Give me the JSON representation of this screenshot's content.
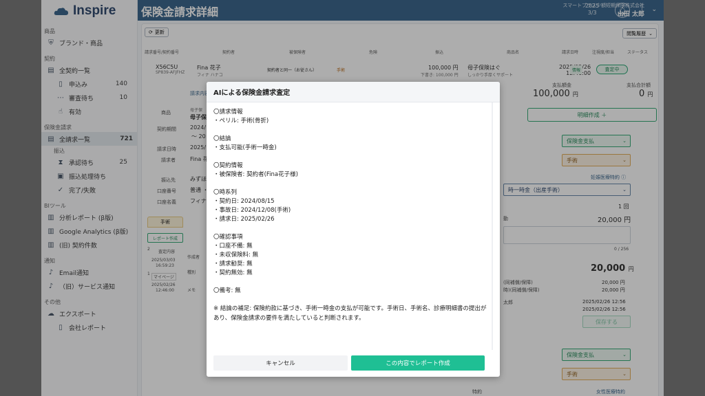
{
  "app": {
    "name": "Inspire"
  },
  "sidebar": {
    "groups": [
      {
        "label": "商品",
        "items": [
          {
            "label": "ブランド・商品",
            "icon": "shield-icon"
          }
        ]
      },
      {
        "label": "契約",
        "items": [
          {
            "label": "全契約一覧",
            "icon": "list-icon"
          },
          {
            "label": "申込み",
            "count": "140",
            "icon": "doc-icon"
          },
          {
            "label": "審査待ち",
            "count": "10",
            "icon": "dots-icon"
          },
          {
            "label": "有効",
            "icon": "hand-icon"
          }
        ]
      },
      {
        "label": "保険金請求",
        "items": [
          {
            "label": "全請求一覧",
            "count": "721",
            "icon": "list-icon"
          }
        ],
        "sublabel": "振込",
        "subitems": [
          {
            "label": "承認待ち",
            "count": "25",
            "icon": "hourglass-icon"
          },
          {
            "label": "振込処理待ち",
            "icon": "transfer-icon"
          },
          {
            "label": "完了/失敗",
            "icon": "done-icon"
          }
        ]
      },
      {
        "label": "BIツール",
        "items": [
          {
            "label": "分析レポート (β版)",
            "icon": "chart-icon"
          },
          {
            "label": "Google Analytics (β版)",
            "icon": "chart-icon"
          },
          {
            "label": "(旧) 契約件数",
            "icon": "chart-icon"
          }
        ]
      },
      {
        "label": "通知",
        "items": [
          {
            "label": "Email通知",
            "icon": "bell-icon"
          },
          {
            "label": "（旧）サービス通知",
            "icon": "bell-icon"
          }
        ]
      },
      {
        "label": "その他",
        "items": [
          {
            "label": "エクスポート",
            "icon": "cloud-icon"
          },
          {
            "label": "会社レポート",
            "icon": "doc-icon"
          }
        ]
      }
    ]
  },
  "header": {
    "title": "保険金請求詳細",
    "year": "2025",
    "date": "3/3",
    "company": "スマートプラス少額短期保険株式会社",
    "user": "山田 太郎"
  },
  "toolbar": {
    "refresh": "更新",
    "history": "閲覧履歴"
  },
  "table": {
    "headers": [
      "請求番号/契約番号",
      "契約者",
      "被保険者",
      "危険",
      "振込",
      "商品名",
      "請求日時",
      "注視度/担当",
      "ステータス"
    ],
    "row": {
      "claim_no": "X56C5U",
      "contract_no": "SP839-AFJFHZ",
      "holder": "Fina 花子",
      "holder_kana": "フィナ ハナコ",
      "insured": "契約者と同一（お従さん）",
      "peril": "手術",
      "amount": "100,000 円",
      "amount_sub": "下書き: 100,000 円",
      "product": "母子保険はぐ",
      "product_sub": "しっかり手厚くサポート",
      "date": "2025/02/26",
      "time": "12:46:00",
      "attention": "情報",
      "status": "査定中"
    }
  },
  "summary": {
    "paid_label": "支払額金",
    "paid_value": "100,000",
    "paid_unit": "円",
    "total_label": "支払合計額",
    "total_value": "0",
    "total_unit": "円",
    "tab_claim": "請求内容"
  },
  "details": {
    "product_label": "商品",
    "product_small": "母子保",
    "product_value": "母子保",
    "period_label": "契約期間",
    "period_value": "2024/",
    "period_value2": "〜 20",
    "date_label": "請求日時",
    "date_value": "2025/",
    "claimant_label": "請求者",
    "claimant_value": "Fina 花",
    "bank_label": "振込先",
    "bank_value": "みずほ",
    "account_no_label": "口座番号",
    "account_no_value": "普通 ・",
    "account_name_label": "口座名義",
    "account_name_value": "フィナ",
    "tab": "手術",
    "report_button": "レポート作成",
    "history_num": "2",
    "history_head": "査定内容",
    "history_date": "2025/03/03",
    "history_time": "16:59:23",
    "history_author": "作成者",
    "history_2": "1",
    "history_tag": "マイページ",
    "history_date2": "2025/02/26",
    "history_time2": "12:46:00",
    "history_type": "種別",
    "history_memo": "メモ"
  },
  "right": {
    "create_button": "明細作成 ＋",
    "type_select": "保険金支払",
    "peril_select": "手術",
    "special": "妊娠医療特約 ⓘ",
    "benefit_select": "時一時金（出産手術）",
    "times": "1 回",
    "amount_label": "動",
    "amount": "20,000 円",
    "char_count": "0 / 256",
    "total": "20,000",
    "total_unit": "円",
    "sub1_label": "(同補償/保障)",
    "sub1_value": "20,000 円",
    "sub2_label": "時)(同補償/保障)",
    "sub2_value": "20,000 円",
    "person": "太郎",
    "dt1": "2025/02/26 12:56",
    "dt2": "2025/02/26 12:56",
    "save": "保存する",
    "type_select2": "保険金支払",
    "peril_select2": "手術",
    "special2_label": "特約",
    "special2": "女性医療特約"
  },
  "modal": {
    "title": "AIによる保険金請求査定",
    "sections": [
      {
        "title": "〇請求情報",
        "lines": [
          "・ペリル: 手術(骨折)"
        ]
      },
      {
        "title": "〇結論",
        "lines": [
          "・支払可能(手術一時金)"
        ]
      },
      {
        "title": "〇契約情報",
        "lines": [
          "・被保険者: 契約者(Fina花子様)"
        ]
      },
      {
        "title": "〇時系列",
        "lines": [
          "・契約日: 2024/08/15",
          "・事故日: 2024/12/08(手術)",
          "・請求日: 2025/02/26"
        ]
      },
      {
        "title": "〇確認事項",
        "lines": [
          "・口座不備: 無",
          "・未収保険料: 無",
          "・請求勧奨: 無",
          "・契約無効: 無"
        ]
      },
      {
        "title": "〇備考: 無",
        "lines": []
      }
    ],
    "note": "※ 結論の補足: 保険約款に基づき、手術一時金の支払が可能です。手術日、手術名、診療明細書の提出があり、保険金請求の要件を満たしていると判断されます。",
    "cancel": "キャンセル",
    "confirm": "この内容でレポート作成"
  },
  "colors": {
    "header": "#2b5a83",
    "accent": "#1fbf94",
    "green": "#18824f"
  }
}
